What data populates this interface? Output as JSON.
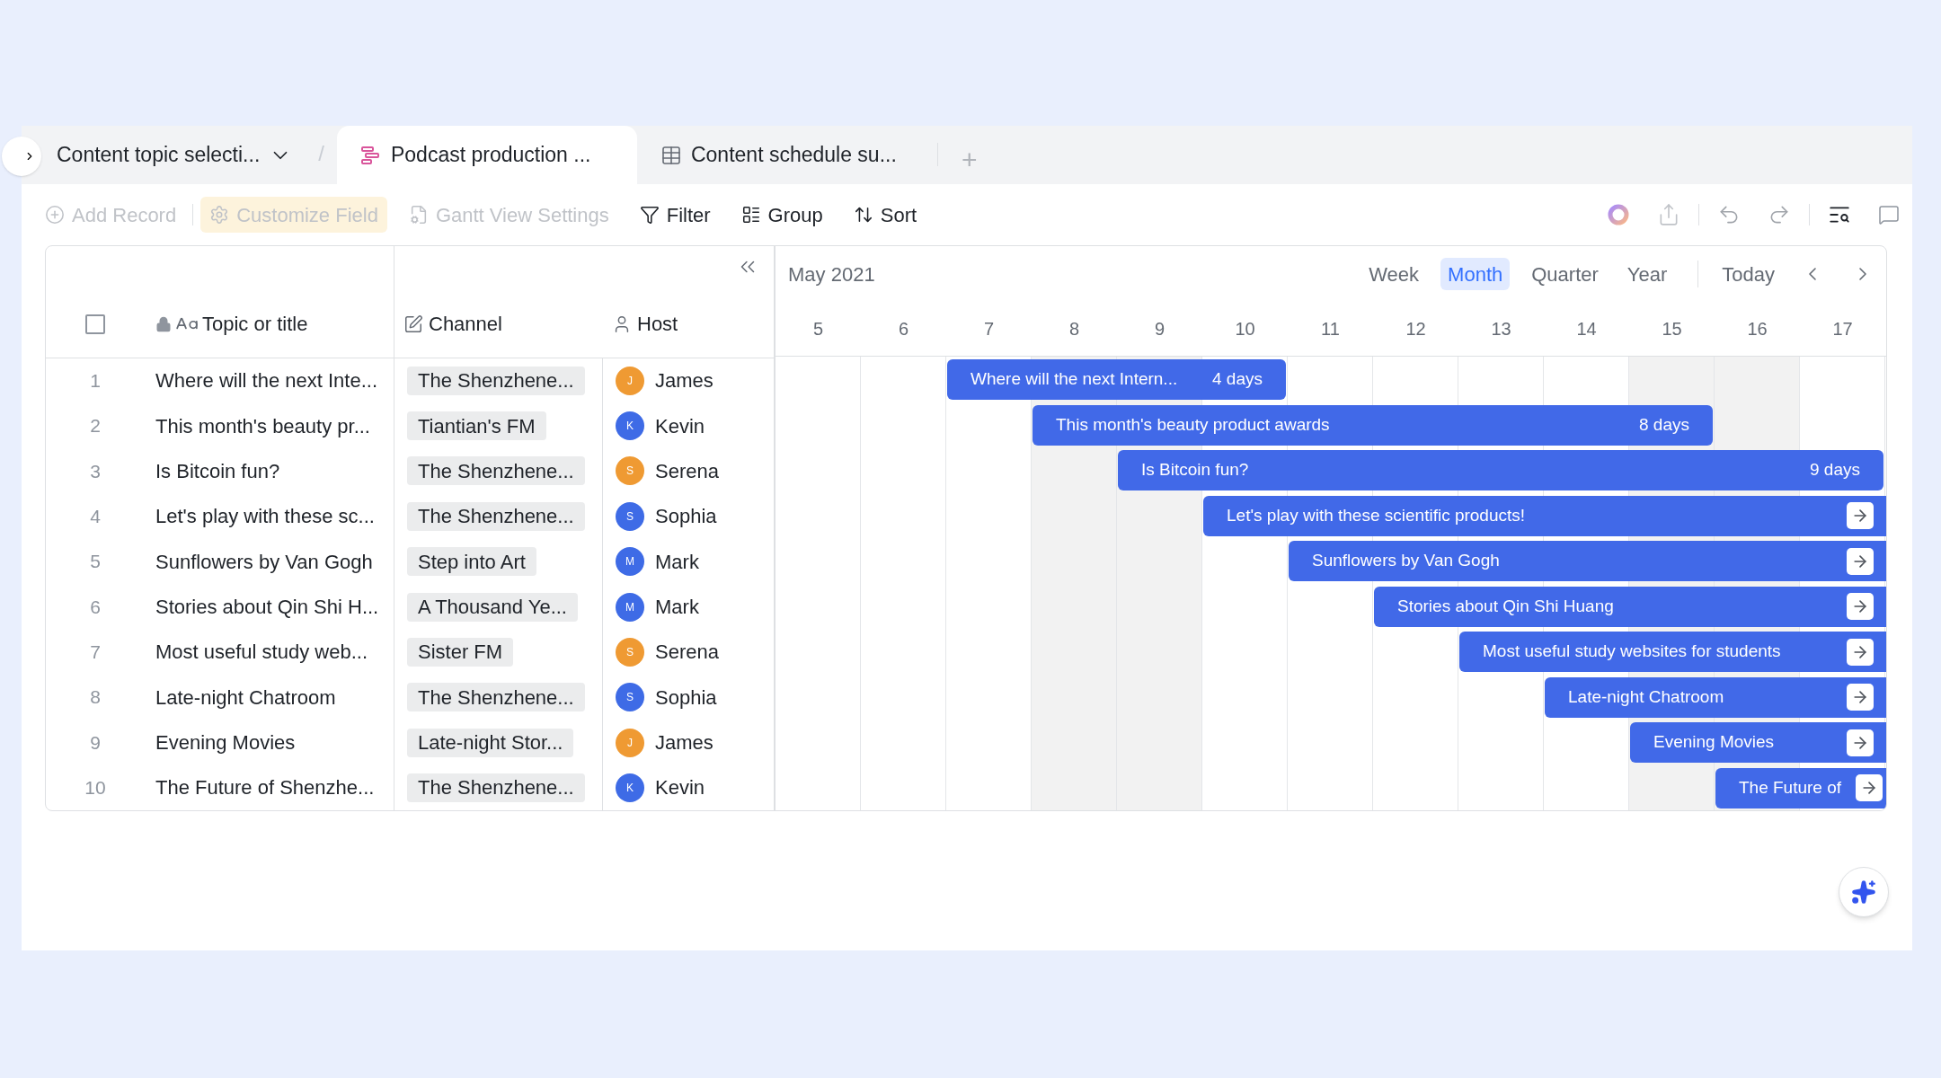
{
  "tabs": [
    {
      "label": "Content topic selecti...",
      "kind": "dropdown",
      "selected": false
    },
    {
      "label": "Podcast production ...",
      "kind": "gantt",
      "selected": true
    },
    {
      "label": "Content schedule su...",
      "kind": "table",
      "selected": false
    }
  ],
  "breadcrumb_separator": "/",
  "add_tab": "+",
  "toolbar": [
    {
      "label": "Add Record",
      "kind": "add",
      "disabled": true,
      "highlighted": false
    },
    {
      "label": "Customize Field",
      "kind": "gear",
      "disabled": true,
      "highlighted": true
    },
    {
      "label": "Gantt View Settings",
      "kind": "settings",
      "disabled": true,
      "highlighted": false
    },
    {
      "label": "Filter",
      "kind": "filter",
      "disabled": false,
      "highlighted": false
    },
    {
      "label": "Group",
      "kind": "group",
      "disabled": false,
      "highlighted": false
    },
    {
      "label": "Sort",
      "kind": "sort",
      "disabled": false,
      "highlighted": false
    }
  ],
  "table": {
    "select_all": {
      "checked": false
    },
    "columns": [
      {
        "label": "Topic or title",
        "kind": "text"
      },
      {
        "label": "Channel",
        "kind": "channel"
      },
      {
        "label": "Host",
        "kind": "person"
      }
    ],
    "rows": [
      {
        "index": "1",
        "topic": "Where will the next Inte...",
        "channel": "The Shenzhene...",
        "host": "James",
        "initial": "J",
        "color": "#ef9a33"
      },
      {
        "index": "2",
        "topic": "This month's beauty pr...",
        "channel": "Tiantian's FM",
        "host": "Kevin",
        "initial": "K",
        "color": "#3e6be6"
      },
      {
        "index": "3",
        "topic": "Is Bitcoin fun?",
        "channel": "The Shenzhene...",
        "host": "Serena",
        "initial": "S",
        "color": "#ef9a33"
      },
      {
        "index": "4",
        "topic": "Let's play with these sc...",
        "channel": "The Shenzhene...",
        "host": "Sophia",
        "initial": "S",
        "color": "#3e6be6"
      },
      {
        "index": "5",
        "topic": "Sunflowers by Van Gogh",
        "channel": "Step into Art",
        "host": "Mark",
        "initial": "M",
        "color": "#3e6be6"
      },
      {
        "index": "6",
        "topic": "Stories about Qin Shi H...",
        "channel": "A Thousand Ye...",
        "host": "Mark",
        "initial": "M",
        "color": "#3e6be6"
      },
      {
        "index": "7",
        "topic": "Most useful study web...",
        "channel": "Sister FM",
        "host": "Serena",
        "initial": "S",
        "color": "#ef9a33"
      },
      {
        "index": "8",
        "topic": "Late-night Chatroom",
        "channel": "The Shenzhene...",
        "host": "Sophia",
        "initial": "S",
        "color": "#3e6be6"
      },
      {
        "index": "9",
        "topic": "Evening Movies",
        "channel": "Late-night Stor...",
        "host": "James",
        "initial": "J",
        "color": "#ef9a33"
      },
      {
        "index": "10",
        "topic": "The Future of Shenzhe...",
        "channel": "The Shenzhene...",
        "host": "Kevin",
        "initial": "K",
        "color": "#3e6be6"
      }
    ]
  },
  "gantt": {
    "month": "May 2021",
    "scales": [
      {
        "label": "Week",
        "selected": false
      },
      {
        "label": "Month",
        "selected": true
      },
      {
        "label": "Quarter",
        "selected": false
      },
      {
        "label": "Year",
        "selected": false
      }
    ],
    "today": "Today",
    "days": [
      {
        "label": "5",
        "weekend": false
      },
      {
        "label": "6",
        "weekend": false
      },
      {
        "label": "7",
        "weekend": false
      },
      {
        "label": "8",
        "weekend": true
      },
      {
        "label": "9",
        "weekend": true
      },
      {
        "label": "10",
        "weekend": false
      },
      {
        "label": "11",
        "weekend": false
      },
      {
        "label": "12",
        "weekend": false
      },
      {
        "label": "13",
        "weekend": false
      },
      {
        "label": "14",
        "weekend": false
      },
      {
        "label": "15",
        "weekend": true
      },
      {
        "label": "16",
        "weekend": true
      },
      {
        "label": "17",
        "weekend": false
      }
    ],
    "bars": [
      {
        "title": "Where will the next Intern...",
        "duration": "4 days",
        "continues": false
      },
      {
        "title": "This month's beauty product awards",
        "duration": "8 days",
        "continues": false
      },
      {
        "title": "Is Bitcoin fun?",
        "duration": "9 days",
        "continues": false
      },
      {
        "title": "Let's play with these scientific products!",
        "continues": true
      },
      {
        "title": "Sunflowers by Van Gogh",
        "continues": true
      },
      {
        "title": "Stories about Qin Shi Huang",
        "continues": true
      },
      {
        "title": "Most useful study websites for students",
        "continues": true
      },
      {
        "title": "Late-night Chatroom",
        "continues": true
      },
      {
        "title": "Evening Movies",
        "continues": true
      },
      {
        "title": "The Future of",
        "continues": true
      }
    ]
  }
}
